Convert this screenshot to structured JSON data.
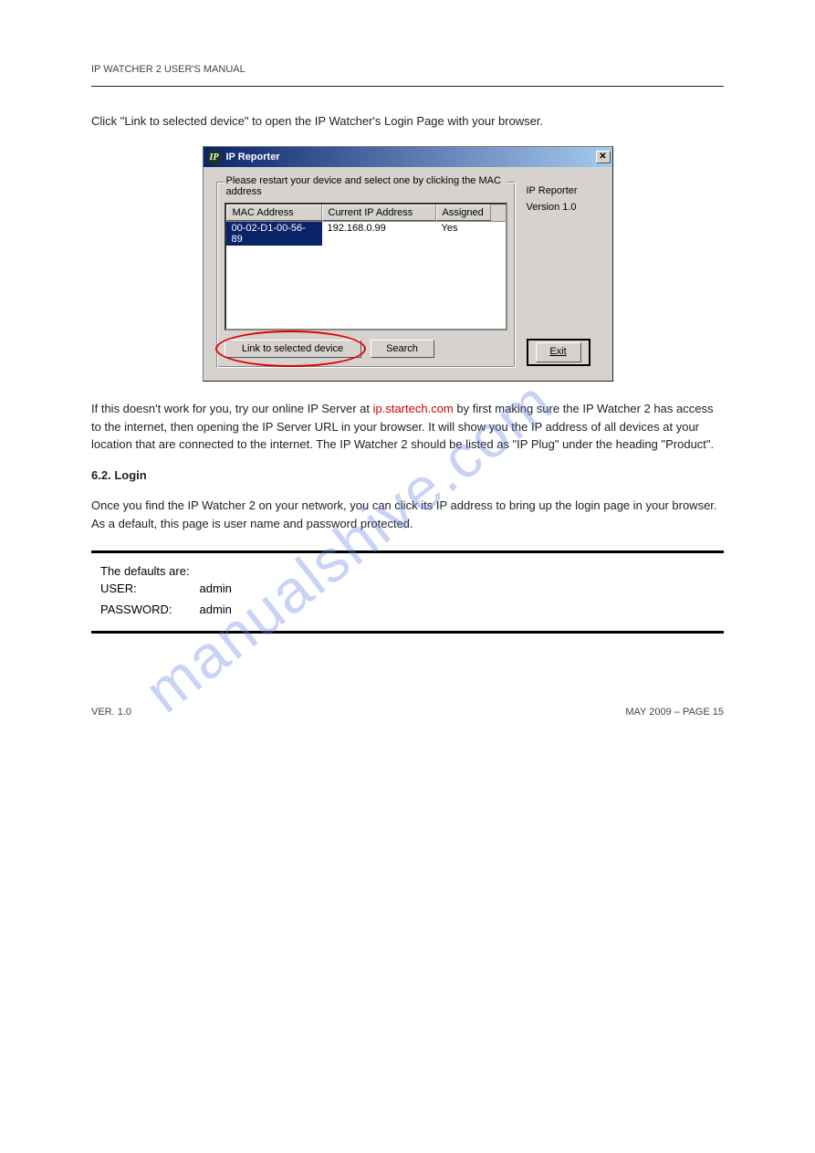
{
  "header": {
    "text": "IP WATCHER 2 USER'S MANUAL"
  },
  "intro": "Click \"Link to selected device\" to open the IP Watcher's Login Page with your browser.",
  "dialog": {
    "title": "IP Reporter",
    "icon_text": "IP",
    "group_caption": "Please restart your device and select one by clicking the MAC address",
    "columns": {
      "mac": "MAC Address",
      "ip": "Current IP Address",
      "assigned": "Assigned"
    },
    "row": {
      "mac": "00-02-D1-00-56-89",
      "ip": "192.168.0.99",
      "assigned": "Yes"
    },
    "buttons": {
      "link": "Link to selected device",
      "search": "Search",
      "exit": "Exit"
    },
    "side": {
      "name": "IP Reporter",
      "version": "Version 1.0"
    }
  },
  "para1": {
    "pre": "If this doesn't work for you, try our online IP Server at ",
    "link_text": "ip.startech.com",
    "post": " by first making sure the IP Watcher 2 has access to the internet, then opening the IP Server URL in your browser. It will show you the IP address of all devices at your location that are connected to the internet. The IP Watcher 2 should be listed as \"IP Plug\" under the heading \"Product\"."
  },
  "section": {
    "num": "6.2.",
    "title": "Login",
    "body": "Once you find the IP Watcher 2 on your network, you can click its IP address to bring up the login page in your browser. As a default, this page is user name and password protected.",
    "defaults_intro": "The defaults are:",
    "user_label": "USER:",
    "user_value": "admin",
    "pass_label": "PASSWORD:",
    "pass_value": "admin"
  },
  "watermark": "manualshive.com",
  "footer": {
    "left": "VER. 1.0",
    "right": "MAY 2009 – PAGE 15"
  }
}
